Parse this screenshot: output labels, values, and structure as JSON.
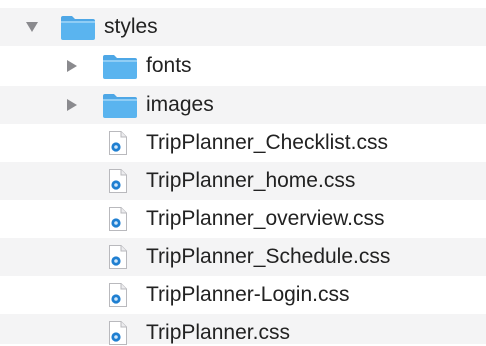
{
  "colors": {
    "folder_fill": "#5ab4ef",
    "folder_tab": "#4ea7e6",
    "folder_edge": "#3d97d8",
    "stripe": "#f4f4f5",
    "file_badge": "#1f7fd1",
    "text": "#222222",
    "chevron": "#8a8a8e"
  },
  "tree": {
    "root": {
      "label": "styles",
      "icon": "folder-icon",
      "expanded": true
    },
    "folders": [
      {
        "label": "fonts",
        "icon": "folder-icon",
        "expanded": false
      },
      {
        "label": "images",
        "icon": "folder-icon",
        "expanded": false
      }
    ],
    "files": [
      {
        "label": "TripPlanner_Checklist.css",
        "icon": "css-file-icon"
      },
      {
        "label": "TripPlanner_home.css",
        "icon": "css-file-icon"
      },
      {
        "label": "TripPlanner_overview.css",
        "icon": "css-file-icon"
      },
      {
        "label": "TripPlanner_Schedule.css",
        "icon": "css-file-icon"
      },
      {
        "label": "TripPlanner-Login.css",
        "icon": "css-file-icon"
      },
      {
        "label": "TripPlanner.css",
        "icon": "css-file-icon"
      }
    ]
  }
}
